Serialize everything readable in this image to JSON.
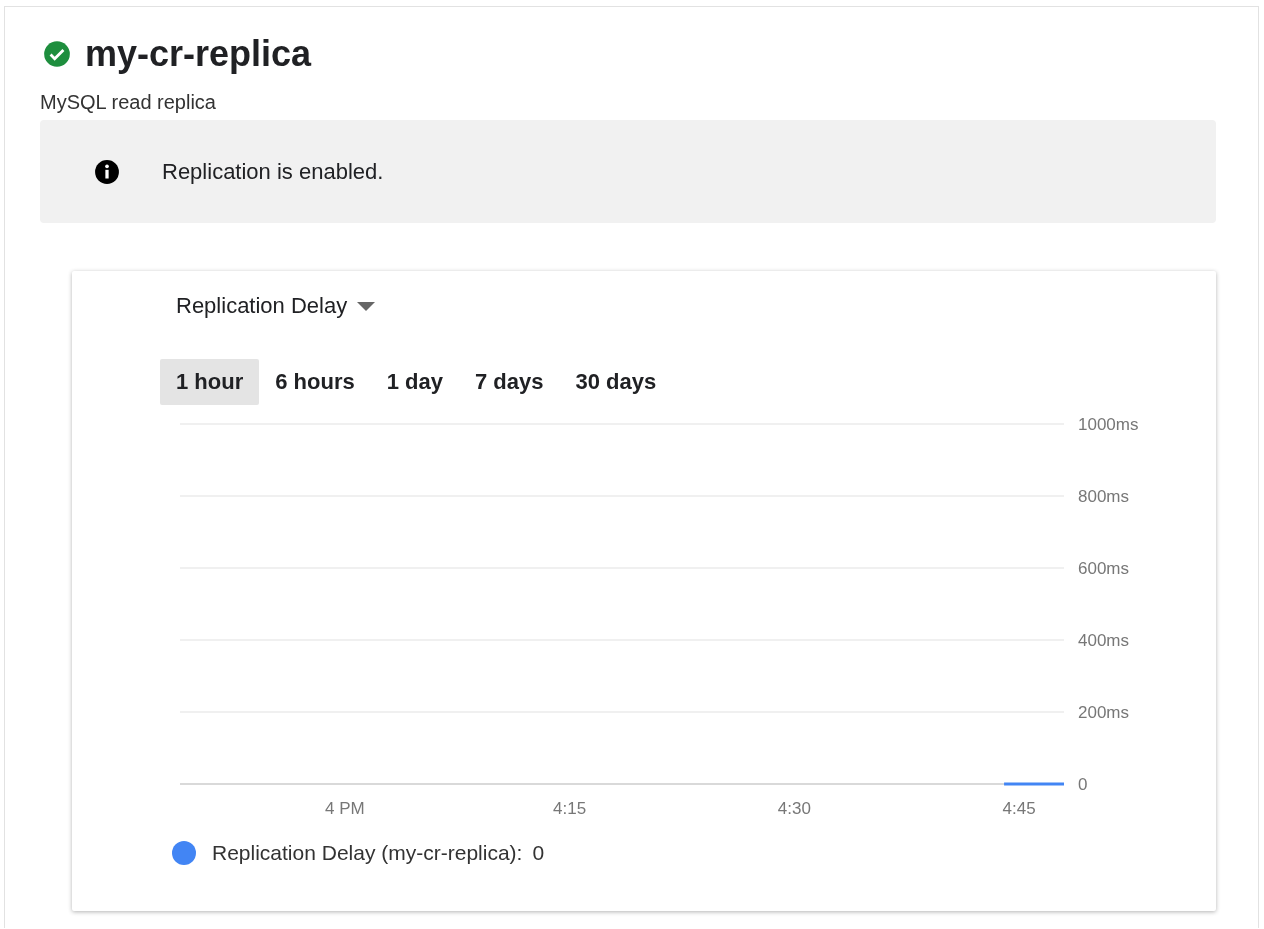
{
  "header": {
    "title": "my-cr-replica",
    "healthy": true,
    "subtitle": "MySQL read replica"
  },
  "banner": {
    "message": "Replication is enabled."
  },
  "metric_selector": {
    "label": "Replication Delay"
  },
  "time_ranges": [
    {
      "label": "1 hour",
      "selected": true
    },
    {
      "label": "6 hours",
      "selected": false
    },
    {
      "label": "1 day",
      "selected": false
    },
    {
      "label": "7 days",
      "selected": false
    },
    {
      "label": "30 days",
      "selected": false
    }
  ],
  "chart_data": {
    "type": "line",
    "grid": true,
    "ylim": [
      0,
      1000
    ],
    "categories": [
      null,
      null,
      null,
      null,
      null,
      null,
      null,
      null,
      null,
      null,
      null,
      "4 PM",
      null,
      null,
      null,
      null,
      null,
      null,
      null,
      null,
      null,
      null,
      null,
      null,
      null,
      null,
      "4:15",
      null,
      null,
      null,
      null,
      null,
      null,
      null,
      null,
      null,
      null,
      null,
      null,
      null,
      null,
      "4:30",
      null,
      null,
      null,
      null,
      null,
      null,
      null,
      null,
      null,
      null,
      null,
      null,
      null,
      null,
      "4:45",
      null,
      null,
      null
    ],
    "yticks": [
      {
        "value": 0,
        "label": "0"
      },
      {
        "value": 200,
        "label": "200ms"
      },
      {
        "value": 400,
        "label": "400ms"
      },
      {
        "value": 600,
        "label": "600ms"
      },
      {
        "value": 800,
        "label": "800ms"
      },
      {
        "value": 1000,
        "label": "1000ms"
      }
    ],
    "series": [
      {
        "color": "#4285f4",
        "values": [
          null,
          null,
          null,
          null,
          null,
          null,
          null,
          null,
          null,
          null,
          null,
          null,
          null,
          null,
          null,
          null,
          null,
          null,
          null,
          null,
          null,
          null,
          null,
          null,
          null,
          null,
          null,
          null,
          null,
          null,
          null,
          null,
          null,
          null,
          null,
          null,
          null,
          null,
          null,
          null,
          null,
          null,
          null,
          null,
          null,
          null,
          null,
          null,
          null,
          null,
          null,
          null,
          null,
          null,
          null,
          0,
          0,
          0,
          0,
          0
        ]
      }
    ]
  },
  "legend": {
    "label": "Replication Delay (my-cr-replica):",
    "value": "0"
  }
}
